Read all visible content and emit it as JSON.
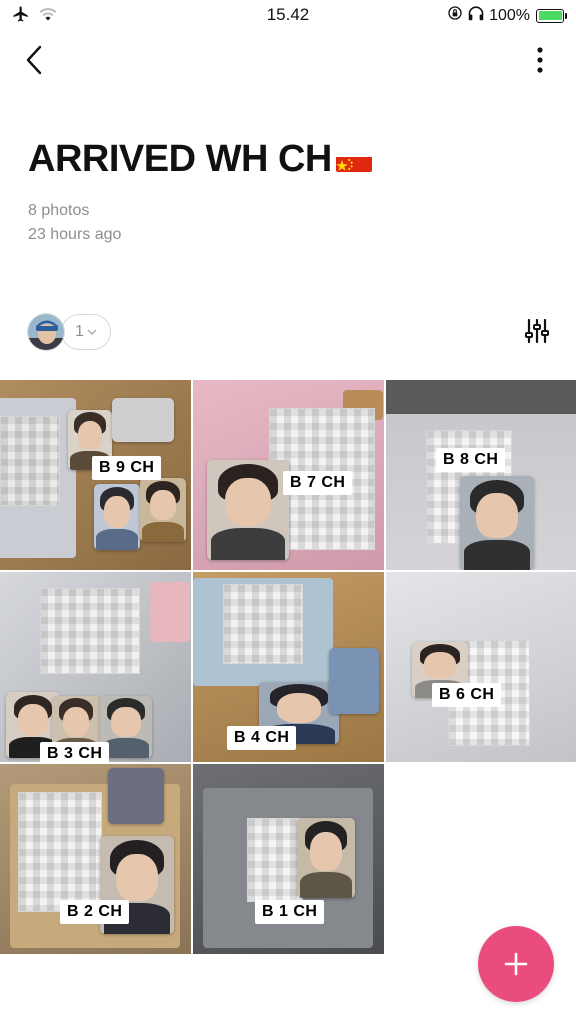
{
  "status_bar": {
    "time": "15.42",
    "battery_percent_label": "100%",
    "battery_level": 1.0,
    "icons": [
      "airplane-icon",
      "wifi-icon",
      "rotation-lock-icon",
      "headphones-icon",
      "battery-icon"
    ]
  },
  "nav": {
    "back_icon": "chevron-left-icon",
    "more_icon": "more-vertical-icon"
  },
  "album": {
    "title": "ARRIVED WH CH",
    "flag_icon": "china-flag-icon",
    "photo_count": "8 photos",
    "updated": "23 hours ago"
  },
  "collaborators": {
    "count": "1",
    "filter_icon": "sliders-icon"
  },
  "photos": [
    {
      "label": "B 9 CH"
    },
    {
      "label": "B 7 CH"
    },
    {
      "label": "B 8 CH"
    },
    {
      "label": "B 3 CH"
    },
    {
      "label": "B 4 CH"
    },
    {
      "label": "B 6 CH"
    },
    {
      "label": "B 2 CH"
    },
    {
      "label": "B 1 CH"
    }
  ],
  "fab": {
    "icon": "plus-icon",
    "color": "#ea4d7d"
  },
  "colors": {
    "secondary_text": "#8e8e93",
    "battery_green": "#4cd964"
  }
}
